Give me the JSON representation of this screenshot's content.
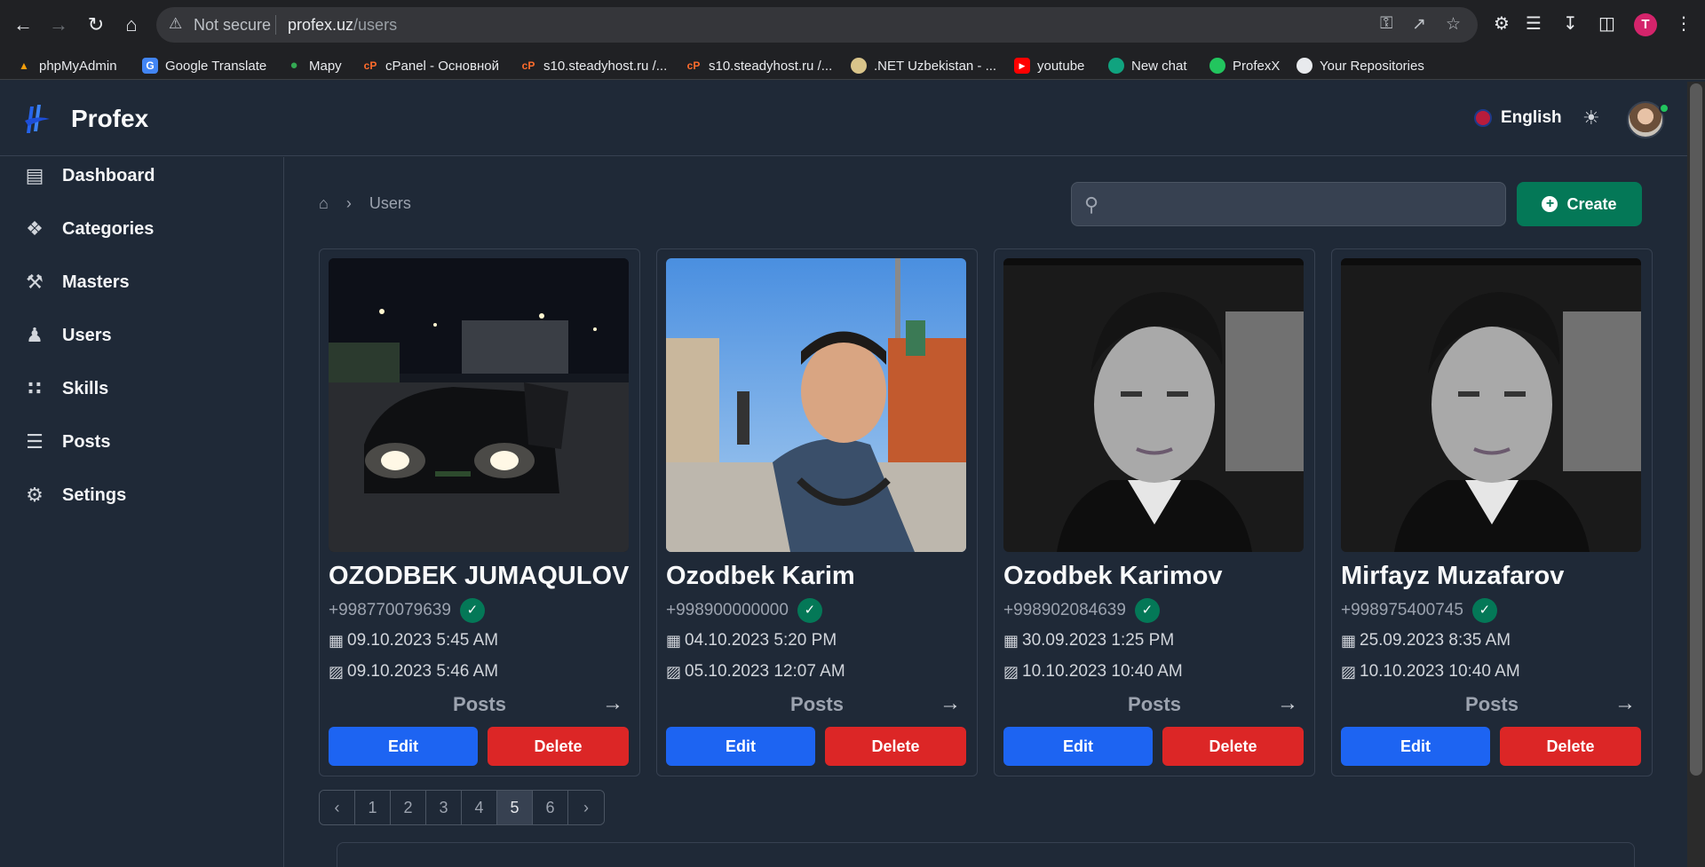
{
  "browser": {
    "not_secure": "Not secure",
    "url_host": "profex.uz",
    "url_path": "/users",
    "profile_initial": "T",
    "bookmarks": [
      {
        "label": "phpMyAdmin",
        "icon": "phpmyadmin-icon",
        "color": "#f59e0b"
      },
      {
        "label": "Google Translate",
        "icon": "google-translate-icon",
        "color": "#4285f4"
      },
      {
        "label": "Mapy",
        "icon": "maps-pin-icon",
        "color": "#34a853"
      },
      {
        "label": "cPanel - Основной",
        "icon": "cpanel-icon",
        "color": "#ff6c2c"
      },
      {
        "label": "s10.steadyhost.ru /...",
        "icon": "cpanel-icon",
        "color": "#ff6c2c"
      },
      {
        "label": "s10.steadyhost.ru /...",
        "icon": "cpanel-icon",
        "color": "#ff6c2c"
      },
      {
        "label": ".NET Uzbekistan - ...",
        "icon": "dotnet-uz-icon",
        "color": "#d9c48a"
      },
      {
        "label": "youtube",
        "icon": "youtube-icon",
        "color": "#ff0000"
      },
      {
        "label": "New chat",
        "icon": "chatgpt-icon",
        "color": "#10a37f"
      },
      {
        "label": "ProfexX",
        "icon": "profexx-icon",
        "color": "#22c55e"
      },
      {
        "label": "Your Repositories",
        "icon": "github-icon",
        "color": "#e8eaed"
      }
    ]
  },
  "header": {
    "app_name": "Profex",
    "language": "English",
    "brand_color": "#2563eb"
  },
  "sidebar": {
    "items": [
      {
        "label": "Dashboard",
        "icon": "dashboard-icon"
      },
      {
        "label": "Categories",
        "icon": "categories-icon"
      },
      {
        "label": "Masters",
        "icon": "hammer-icon"
      },
      {
        "label": "Users",
        "icon": "users-icon"
      },
      {
        "label": "Skills",
        "icon": "skills-icon"
      },
      {
        "label": "Posts",
        "icon": "list-icon"
      },
      {
        "label": "Setings",
        "icon": "gear-icon"
      }
    ]
  },
  "main": {
    "breadcrumb_current": "Users",
    "search_placeholder": "",
    "create_label": "Create",
    "posts_label": "Posts",
    "edit_label": "Edit",
    "delete_label": "Delete",
    "users": [
      {
        "name": "OZODBEK JUMAQULOV",
        "phone": "+998770079639",
        "created": "09.10.2023 5:45 AM",
        "updated": "09.10.2023 5:46 AM",
        "photo": "night-car-photo"
      },
      {
        "name": "Ozodbek Karim",
        "phone": "+998900000000",
        "created": "04.10.2023 5:20 PM",
        "updated": "05.10.2023 12:07 AM",
        "photo": "selfie-square-photo"
      },
      {
        "name": "Ozodbek Karimov",
        "phone": "+998902084639",
        "created": "30.09.2023 1:25 PM",
        "updated": "10.10.2023 10:40 AM",
        "photo": "bw-portrait-photo"
      },
      {
        "name": "Mirfayz Muzafarov",
        "phone": "+998975400745",
        "created": "25.09.2023 8:35 AM",
        "updated": "10.10.2023 10:40 AM",
        "photo": "bw-portrait-photo"
      }
    ],
    "pagination": {
      "pages": [
        "1",
        "2",
        "3",
        "4",
        "5",
        "6"
      ],
      "current": "5"
    }
  }
}
